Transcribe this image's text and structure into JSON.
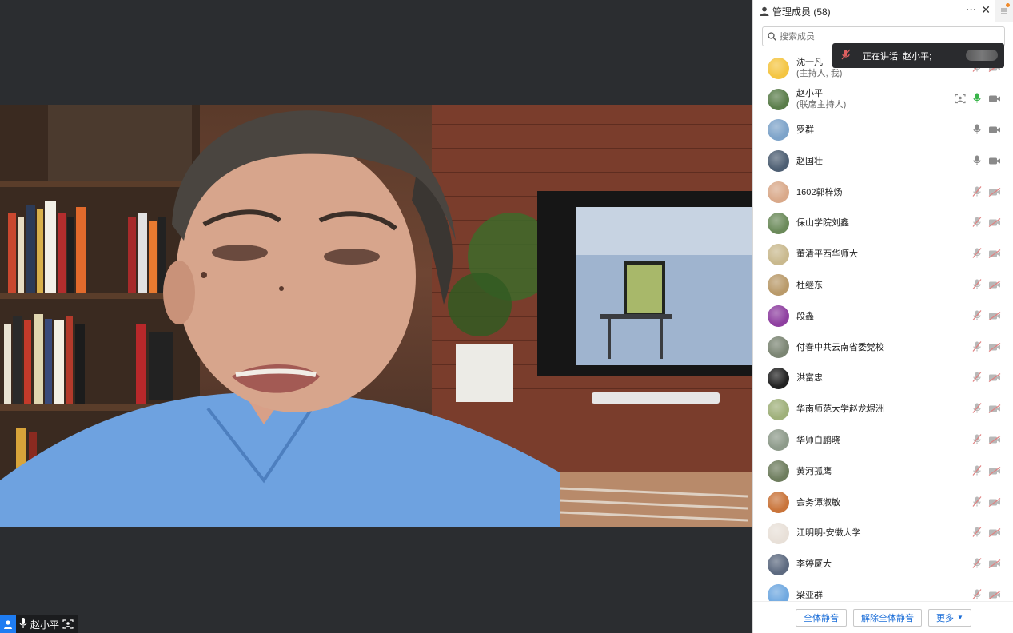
{
  "stage": {
    "speaker_name": "赵小平"
  },
  "sidebar": {
    "title": "管理成员 (58)",
    "more_label": "···",
    "close_label": "✕",
    "search_placeholder": "搜索成员"
  },
  "tooltip": {
    "text": "正在讲话: 赵小平;"
  },
  "members": [
    {
      "name": "沈一凡",
      "role": "(主持人, 我)",
      "avatar_color": "#f4c542",
      "mic": "muted",
      "cam": "off"
    },
    {
      "name": "赵小平",
      "role": "(联席主持人)",
      "avatar_color": "#5a7d4a",
      "mic": "active",
      "cam": "on",
      "share": true
    },
    {
      "name": "罗群",
      "role": "",
      "avatar_color": "#7da3c9",
      "mic": "on",
      "cam": "on"
    },
    {
      "name": "赵国壮",
      "role": "",
      "avatar_color": "#4e5f73",
      "mic": "on",
      "cam": "on"
    },
    {
      "name": "1602郭梓炀",
      "role": "",
      "avatar_color": "#d9a98a",
      "mic": "muted",
      "cam": "off"
    },
    {
      "name": "保山学院刘鑫",
      "role": "",
      "avatar_color": "#6b8a5a",
      "mic": "muted",
      "cam": "off"
    },
    {
      "name": "董清平西华师大",
      "role": "",
      "avatar_color": "#c9b98e",
      "mic": "muted",
      "cam": "off"
    },
    {
      "name": "杜继东",
      "role": "",
      "avatar_color": "#b99a6a",
      "mic": "muted",
      "cam": "off"
    },
    {
      "name": "段鑫",
      "role": "",
      "avatar_color": "#8e3fa0",
      "mic": "muted",
      "cam": "off"
    },
    {
      "name": "付春中共云南省委党校",
      "role": "",
      "avatar_color": "#7b8573",
      "mic": "muted",
      "cam": "off"
    },
    {
      "name": "洪富忠",
      "role": "",
      "avatar_color": "#222222",
      "mic": "muted",
      "cam": "off"
    },
    {
      "name": "华南师范大学赵龙煜洲",
      "role": "",
      "avatar_color": "#9fb07a",
      "mic": "muted",
      "cam": "off"
    },
    {
      "name": "华师白鹏晓",
      "role": "",
      "avatar_color": "#8d9a8a",
      "mic": "muted",
      "cam": "off"
    },
    {
      "name": "黄河孤鹰",
      "role": "",
      "avatar_color": "#6e7d5e",
      "mic": "muted",
      "cam": "off"
    },
    {
      "name": "会务谭淑敏",
      "role": "",
      "avatar_color": "#c9743a",
      "mic": "muted",
      "cam": "off"
    },
    {
      "name": "江明明-安徽大学",
      "role": "",
      "avatar_color": "#e8e0d8",
      "mic": "muted",
      "cam": "off"
    },
    {
      "name": "李婷厦大",
      "role": "",
      "avatar_color": "#5d6a80",
      "mic": "muted",
      "cam": "off"
    },
    {
      "name": "梁亚群",
      "role": "",
      "avatar_color": "#6fa8e0",
      "mic": "muted",
      "cam": "off"
    }
  ],
  "footer": {
    "mute_all": "全体静音",
    "unmute_all": "解除全体静音",
    "more": "更多"
  },
  "colors": {
    "accent": "#1d6fd8",
    "mic_active": "#39b54a",
    "muted_icon": "#c0c0c0"
  }
}
